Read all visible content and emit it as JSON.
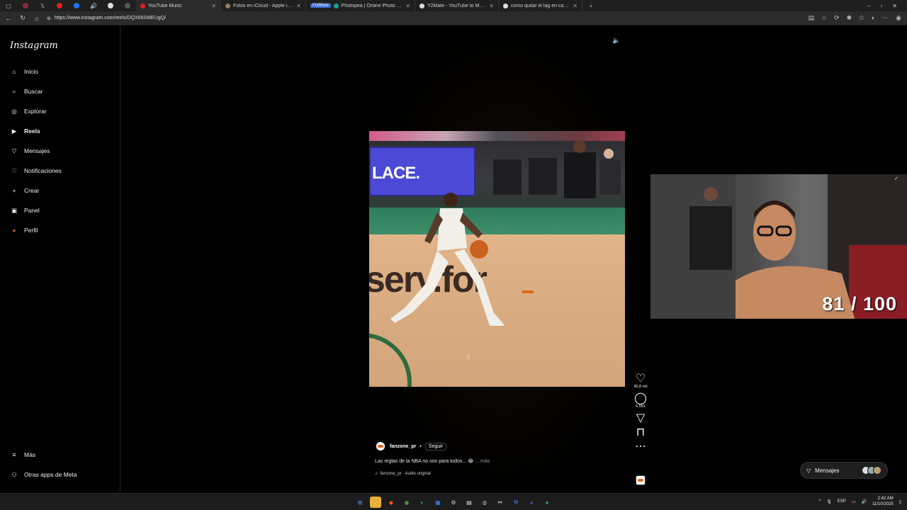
{
  "browser": {
    "tabs": [
      {
        "title": "YouTube Music",
        "fav": "#e02020"
      },
      {
        "title": "Fotos en iCloud - Apple iCloud",
        "fav": "#9b7a5a"
      },
      {
        "title": "Photopea | Online Photo Editor",
        "fav": "#18a497",
        "badge": "FORNAI"
      },
      {
        "title": "Y2Mate - YouTube to MP3 Conv...",
        "fav": "#dddddd"
      },
      {
        "title": "como quitar el lag en capcut pc...",
        "fav": "#dddddd"
      }
    ],
    "new_tab": "+",
    "url": "https://www.instagram.com/reels/DQX66SMEUgQ/",
    "window_controls": [
      "–",
      "▫",
      "✕"
    ]
  },
  "sidebar": {
    "logo": "Instagram",
    "items": [
      {
        "label": "Inicio",
        "icon": "home-icon",
        "glyph": "⌂"
      },
      {
        "label": "Buscar",
        "icon": "search-icon",
        "glyph": "⌕"
      },
      {
        "label": "Explorar",
        "icon": "compass-icon",
        "glyph": "◎"
      },
      {
        "label": "Reels",
        "icon": "reels-icon",
        "glyph": "▶"
      },
      {
        "label": "Mensajes",
        "icon": "send-icon",
        "glyph": "▽"
      },
      {
        "label": "Notificaciones",
        "icon": "heart-icon",
        "glyph": "♡"
      },
      {
        "label": "Crear",
        "icon": "plus-icon",
        "glyph": "+"
      },
      {
        "label": "Panel",
        "icon": "dashboard-icon",
        "glyph": "▣"
      },
      {
        "label": "Perfil",
        "icon": "avatar-icon",
        "glyph": "●"
      }
    ],
    "bottom": [
      {
        "label": "Más",
        "icon": "menu-icon",
        "glyph": "≡"
      },
      {
        "label": "Otras apps de Meta",
        "icon": "meta-apps-icon",
        "glyph": "⚇"
      }
    ]
  },
  "reel": {
    "video_scoreboard_text": "LACE.",
    "video_floor_text": "serv.for",
    "likes": "45,8 mil",
    "comments": "6.081",
    "author": "fanzone_pr",
    "separator": "•",
    "follow_label": "Seguir",
    "caption": "Las reglas de la NBA no son para todos... 😂",
    "more_label": "... más",
    "audio": "fanzone_pr · Audio original"
  },
  "webcam": {
    "counter": "81 / 100"
  },
  "messages": {
    "label": "Mensajes"
  },
  "taskbar": {
    "lang": "ESP",
    "time": "2:42 AM",
    "date": "11/10/2025"
  }
}
